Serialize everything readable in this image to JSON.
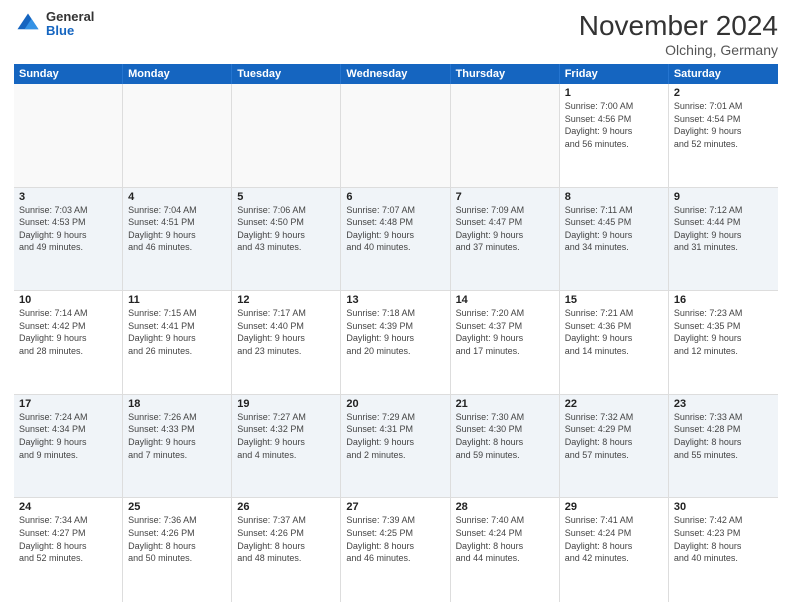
{
  "logo": {
    "general": "General",
    "blue": "Blue"
  },
  "title": "November 2024",
  "subtitle": "Olching, Germany",
  "days_header": [
    "Sunday",
    "Monday",
    "Tuesday",
    "Wednesday",
    "Thursday",
    "Friday",
    "Saturday"
  ],
  "weeks": [
    [
      {
        "day": "",
        "info": ""
      },
      {
        "day": "",
        "info": ""
      },
      {
        "day": "",
        "info": ""
      },
      {
        "day": "",
        "info": ""
      },
      {
        "day": "",
        "info": ""
      },
      {
        "day": "1",
        "info": "Sunrise: 7:00 AM\nSunset: 4:56 PM\nDaylight: 9 hours\nand 56 minutes."
      },
      {
        "day": "2",
        "info": "Sunrise: 7:01 AM\nSunset: 4:54 PM\nDaylight: 9 hours\nand 52 minutes."
      }
    ],
    [
      {
        "day": "3",
        "info": "Sunrise: 7:03 AM\nSunset: 4:53 PM\nDaylight: 9 hours\nand 49 minutes."
      },
      {
        "day": "4",
        "info": "Sunrise: 7:04 AM\nSunset: 4:51 PM\nDaylight: 9 hours\nand 46 minutes."
      },
      {
        "day": "5",
        "info": "Sunrise: 7:06 AM\nSunset: 4:50 PM\nDaylight: 9 hours\nand 43 minutes."
      },
      {
        "day": "6",
        "info": "Sunrise: 7:07 AM\nSunset: 4:48 PM\nDaylight: 9 hours\nand 40 minutes."
      },
      {
        "day": "7",
        "info": "Sunrise: 7:09 AM\nSunset: 4:47 PM\nDaylight: 9 hours\nand 37 minutes."
      },
      {
        "day": "8",
        "info": "Sunrise: 7:11 AM\nSunset: 4:45 PM\nDaylight: 9 hours\nand 34 minutes."
      },
      {
        "day": "9",
        "info": "Sunrise: 7:12 AM\nSunset: 4:44 PM\nDaylight: 9 hours\nand 31 minutes."
      }
    ],
    [
      {
        "day": "10",
        "info": "Sunrise: 7:14 AM\nSunset: 4:42 PM\nDaylight: 9 hours\nand 28 minutes."
      },
      {
        "day": "11",
        "info": "Sunrise: 7:15 AM\nSunset: 4:41 PM\nDaylight: 9 hours\nand 26 minutes."
      },
      {
        "day": "12",
        "info": "Sunrise: 7:17 AM\nSunset: 4:40 PM\nDaylight: 9 hours\nand 23 minutes."
      },
      {
        "day": "13",
        "info": "Sunrise: 7:18 AM\nSunset: 4:39 PM\nDaylight: 9 hours\nand 20 minutes."
      },
      {
        "day": "14",
        "info": "Sunrise: 7:20 AM\nSunset: 4:37 PM\nDaylight: 9 hours\nand 17 minutes."
      },
      {
        "day": "15",
        "info": "Sunrise: 7:21 AM\nSunset: 4:36 PM\nDaylight: 9 hours\nand 14 minutes."
      },
      {
        "day": "16",
        "info": "Sunrise: 7:23 AM\nSunset: 4:35 PM\nDaylight: 9 hours\nand 12 minutes."
      }
    ],
    [
      {
        "day": "17",
        "info": "Sunrise: 7:24 AM\nSunset: 4:34 PM\nDaylight: 9 hours\nand 9 minutes."
      },
      {
        "day": "18",
        "info": "Sunrise: 7:26 AM\nSunset: 4:33 PM\nDaylight: 9 hours\nand 7 minutes."
      },
      {
        "day": "19",
        "info": "Sunrise: 7:27 AM\nSunset: 4:32 PM\nDaylight: 9 hours\nand 4 minutes."
      },
      {
        "day": "20",
        "info": "Sunrise: 7:29 AM\nSunset: 4:31 PM\nDaylight: 9 hours\nand 2 minutes."
      },
      {
        "day": "21",
        "info": "Sunrise: 7:30 AM\nSunset: 4:30 PM\nDaylight: 8 hours\nand 59 minutes."
      },
      {
        "day": "22",
        "info": "Sunrise: 7:32 AM\nSunset: 4:29 PM\nDaylight: 8 hours\nand 57 minutes."
      },
      {
        "day": "23",
        "info": "Sunrise: 7:33 AM\nSunset: 4:28 PM\nDaylight: 8 hours\nand 55 minutes."
      }
    ],
    [
      {
        "day": "24",
        "info": "Sunrise: 7:34 AM\nSunset: 4:27 PM\nDaylight: 8 hours\nand 52 minutes."
      },
      {
        "day": "25",
        "info": "Sunrise: 7:36 AM\nSunset: 4:26 PM\nDaylight: 8 hours\nand 50 minutes."
      },
      {
        "day": "26",
        "info": "Sunrise: 7:37 AM\nSunset: 4:26 PM\nDaylight: 8 hours\nand 48 minutes."
      },
      {
        "day": "27",
        "info": "Sunrise: 7:39 AM\nSunset: 4:25 PM\nDaylight: 8 hours\nand 46 minutes."
      },
      {
        "day": "28",
        "info": "Sunrise: 7:40 AM\nSunset: 4:24 PM\nDaylight: 8 hours\nand 44 minutes."
      },
      {
        "day": "29",
        "info": "Sunrise: 7:41 AM\nSunset: 4:24 PM\nDaylight: 8 hours\nand 42 minutes."
      },
      {
        "day": "30",
        "info": "Sunrise: 7:42 AM\nSunset: 4:23 PM\nDaylight: 8 hours\nand 40 minutes."
      }
    ]
  ]
}
